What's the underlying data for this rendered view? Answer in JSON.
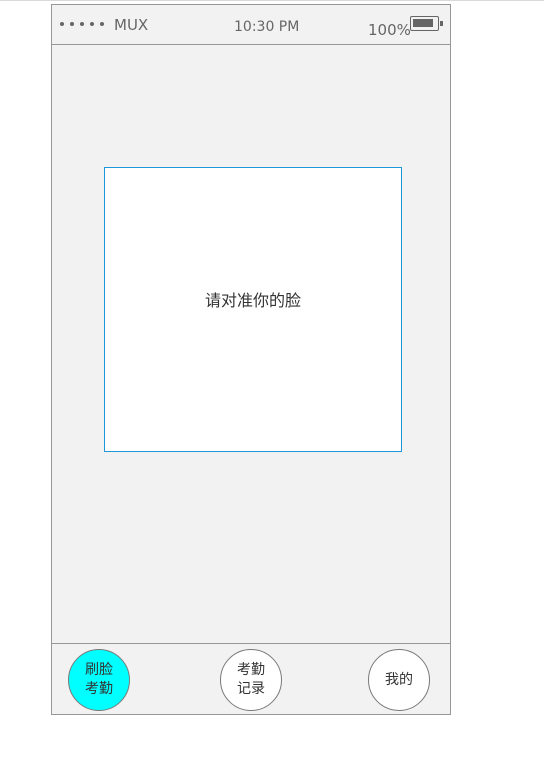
{
  "status_bar": {
    "carrier": "MUX",
    "time": "10:30 PM",
    "battery_percent": "100%"
  },
  "main": {
    "face_prompt": "请对准你的脸"
  },
  "bottom_nav": {
    "items": [
      {
        "label": "刷脸考勤",
        "active": true
      },
      {
        "label": "考勤记录",
        "active": false
      },
      {
        "label": "我的",
        "active": false
      }
    ],
    "active_color": "#00ffff"
  },
  "colors": {
    "frame_border": "#1e98d7",
    "background": "#f2f2f2"
  }
}
